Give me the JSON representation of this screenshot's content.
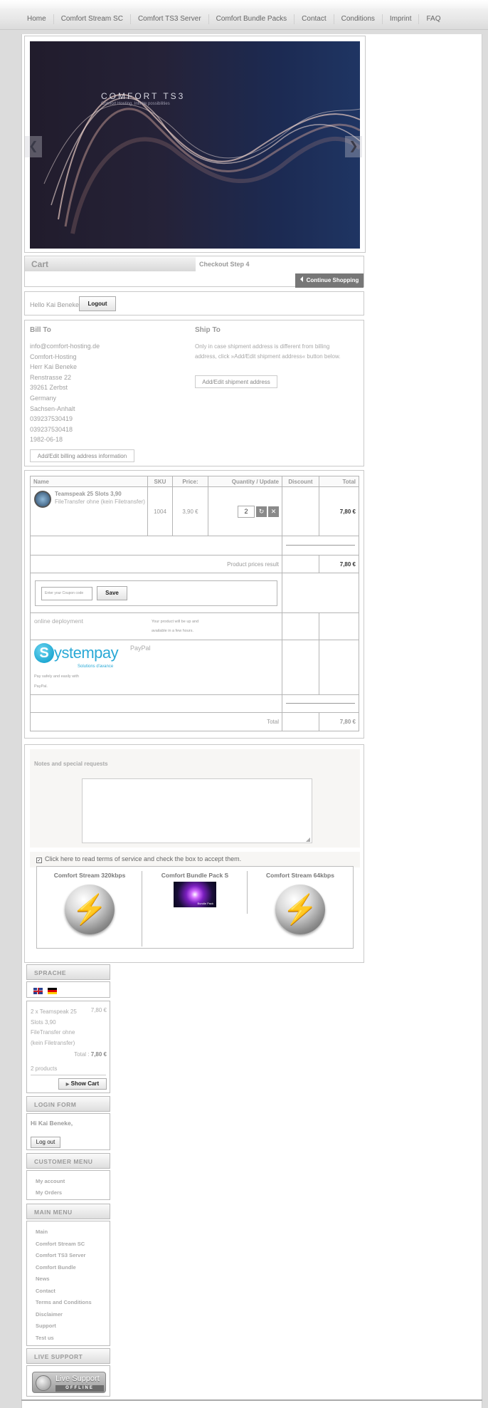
{
  "nav": {
    "items": [
      "Home",
      "Comfort Stream SC",
      "Comfort TS3 Server",
      "Comfort Bundle Packs",
      "Contact",
      "Conditions",
      "Imprint",
      "FAQ"
    ]
  },
  "banner": {
    "title": "COMFORT TS3",
    "subtitle": "Comfort Hosting. Infinite possibilities",
    "prev": "❮",
    "next": "❯"
  },
  "cart": {
    "title": "Cart",
    "step": "Checkout Step 4",
    "continue": "Continue Shopping"
  },
  "user": {
    "hello": "Hello Kai Beneke",
    "logout": "Logout"
  },
  "bill_to": {
    "title": "Bill To",
    "lines": [
      "info@comfort-hosting.de",
      "Comfort-Hosting",
      "Herr Kai Beneke",
      "Renstrasse 22",
      "39261 Zerbst",
      "Germany",
      "Sachsen-Anhalt",
      "039237530419",
      "039237530418",
      "1982-06-18"
    ],
    "edit_button": "Add/Edit billing address information"
  },
  "ship_to": {
    "title": "Ship To",
    "text": "Only in case shipment address is different from billing address, click »Add/Edit shipment address« button below.",
    "button": "Add/Edit shipment address"
  },
  "order": {
    "headers": {
      "name": "Name",
      "sku": "SKU",
      "price": "Price:",
      "qty": "Quantity / Update",
      "discount": "Discount",
      "total": "Total"
    },
    "product": {
      "name": "Teamspeak 25 Slots 3,90",
      "desc": "FileTransfer ohne (kein Filetransfer)",
      "sku": "1004",
      "price": "3,90 €",
      "qty": "2",
      "total": "7,80 €",
      "refresh": "↻",
      "remove": "✕"
    },
    "prices_label": "Product prices result",
    "prices_value": "7,80 €",
    "coupon_placeholder": "Enter your Coupon code",
    "coupon_button": "Save",
    "shipment": {
      "name": "online deployment",
      "note": "Your product will be up and available in a few hours."
    },
    "payment": {
      "logo_letter": "S",
      "logo_text": "ystempay",
      "logo_tagline": "Solutions d'avance",
      "name": "PayPal",
      "desc": "Pay safely and easily with PayPal."
    },
    "total_label": "Total",
    "total_value": "7,80 €"
  },
  "notes": {
    "label": "Notes and special requests"
  },
  "terms": {
    "text": "Click here to read terms of service and check the box to accept them.",
    "check": "✓"
  },
  "promo": [
    {
      "title": "Comfort Stream 320kbps"
    },
    {
      "title": "Comfort Bundle Pack S",
      "img_text": "Bundle Pack"
    },
    {
      "title": "Comfort Stream 64kbps"
    }
  ],
  "sidebar": {
    "sprache": "SPRACHE",
    "mini_cart": {
      "item": "2 x Teamspeak 25 Slots 3,90 FileTransfer ohne (kein Filetransfer)",
      "item_price": "7,80 €",
      "total_label": "Total :",
      "total_value": "7,80 €",
      "count": "2 products",
      "show_cart": "Show Cart"
    },
    "login": {
      "title": "LOGIN FORM",
      "greeting": "Hi Kai Beneke,",
      "logout": "Log out"
    },
    "customer_menu": {
      "title": "CUSTOMER MENU",
      "items": [
        "My account",
        "My Orders"
      ]
    },
    "main_menu": {
      "title": "MAIN MENU",
      "items": [
        "Main",
        "Comfort Stream SC",
        "Comfort TS3 Server",
        "Comfort Bundle",
        "News",
        "Contact",
        "Terms and Conditions",
        "Disclaimer",
        "Support",
        "Test us"
      ]
    },
    "live_support": {
      "title": "LIVE SUPPORT",
      "text": "Live Support",
      "status": "OFFLINE"
    }
  }
}
